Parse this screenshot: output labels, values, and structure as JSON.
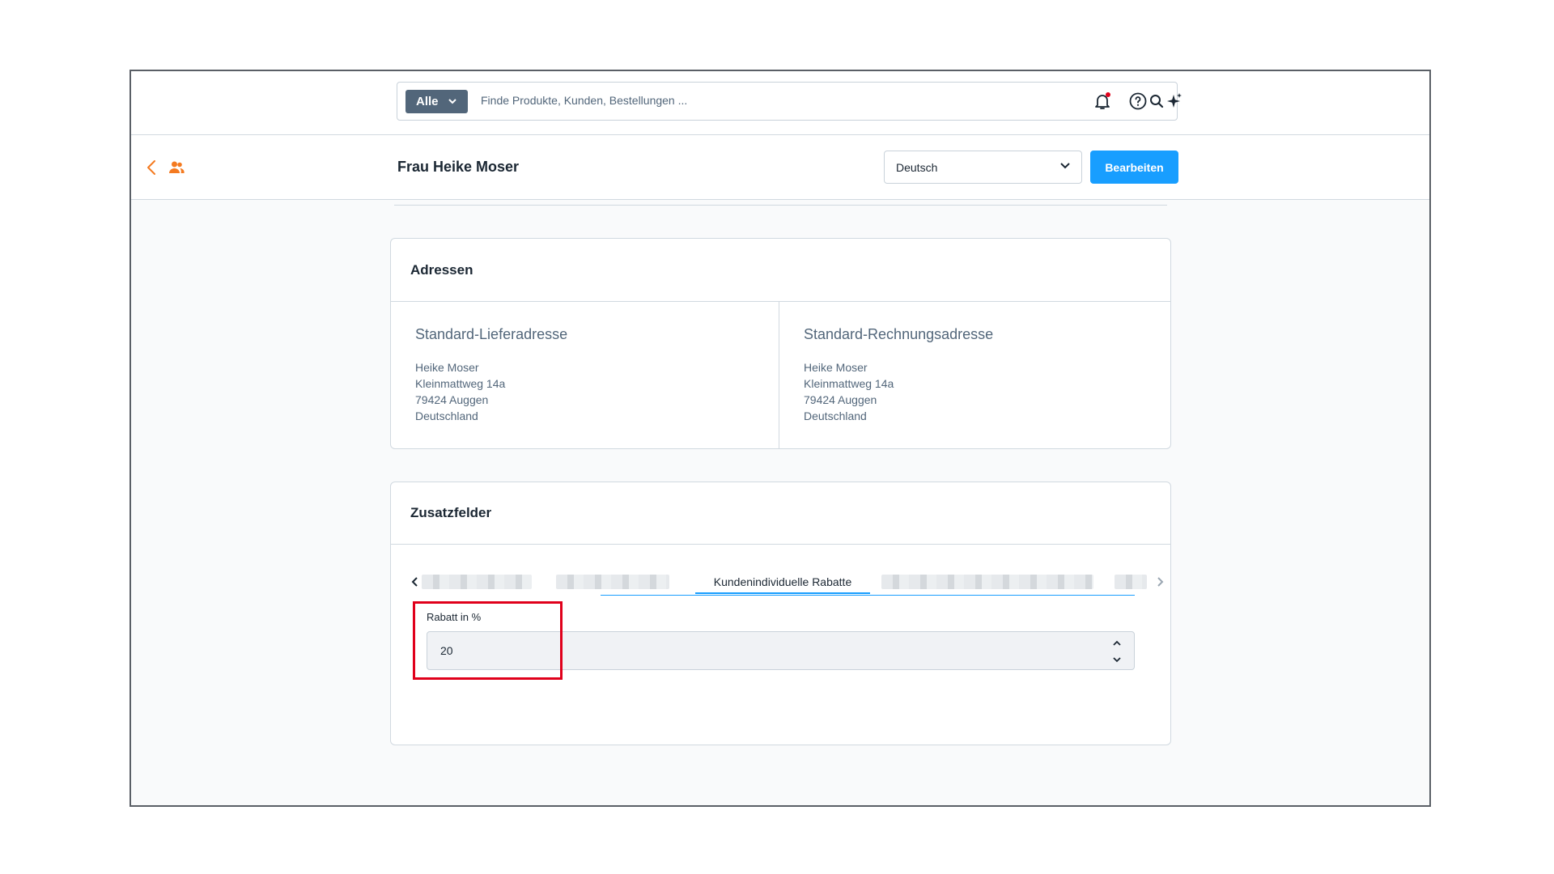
{
  "search": {
    "scope_label": "Alle",
    "placeholder": "Finde Produkte, Kunden, Bestellungen ..."
  },
  "header": {
    "title": "Frau Heike Moser",
    "language": "Deutsch",
    "edit_label": "Bearbeiten"
  },
  "addresses": {
    "title": "Adressen",
    "shipping": {
      "heading": "Standard-Lieferadresse",
      "lines": [
        "Heike Moser",
        "Kleinmattweg 14a",
        "79424 Auggen",
        "Deutschland"
      ]
    },
    "billing": {
      "heading": "Standard-Rechnungsadresse",
      "lines": [
        "Heike Moser",
        "Kleinmattweg 14a",
        "79424 Auggen",
        "Deutschland"
      ]
    }
  },
  "custom_fields": {
    "title": "Zusatzfelder",
    "active_tab": "Kundenindividuelle Rabatte",
    "field_label": "Rabatt in %",
    "field_value": "20"
  },
  "colors": {
    "accent": "#189eff",
    "brand_orange": "#f47a20",
    "highlight": "#e0001b"
  },
  "icons": [
    "chevron-down-icon",
    "search-icon",
    "bell-icon",
    "help-icon",
    "sparkles-icon",
    "back-icon",
    "users-icon",
    "chevron-left-icon",
    "chevron-right-icon",
    "stepper-icon"
  ]
}
